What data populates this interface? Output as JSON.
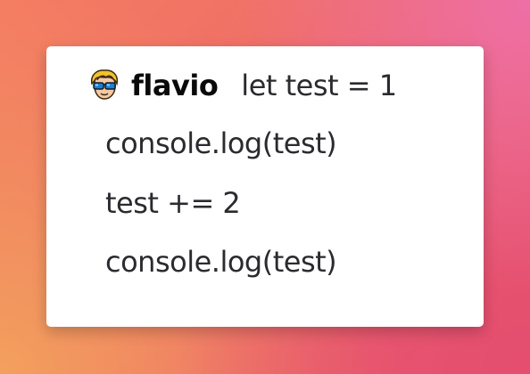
{
  "message": {
    "author": "flavio",
    "avatar_icon": "sunglasses-avatar-icon",
    "lines": [
      "let test = 1",
      "console.log(test)",
      "test += 2",
      "console.log(test)"
    ]
  },
  "colors": {
    "background_top_left": "#f47c62",
    "background_top_right": "#ee6fa6",
    "background_bottom_left": "#f3a05d",
    "background_bottom_right": "#e54e6f",
    "card": "#ffffff",
    "text": "#2b2b2f"
  }
}
